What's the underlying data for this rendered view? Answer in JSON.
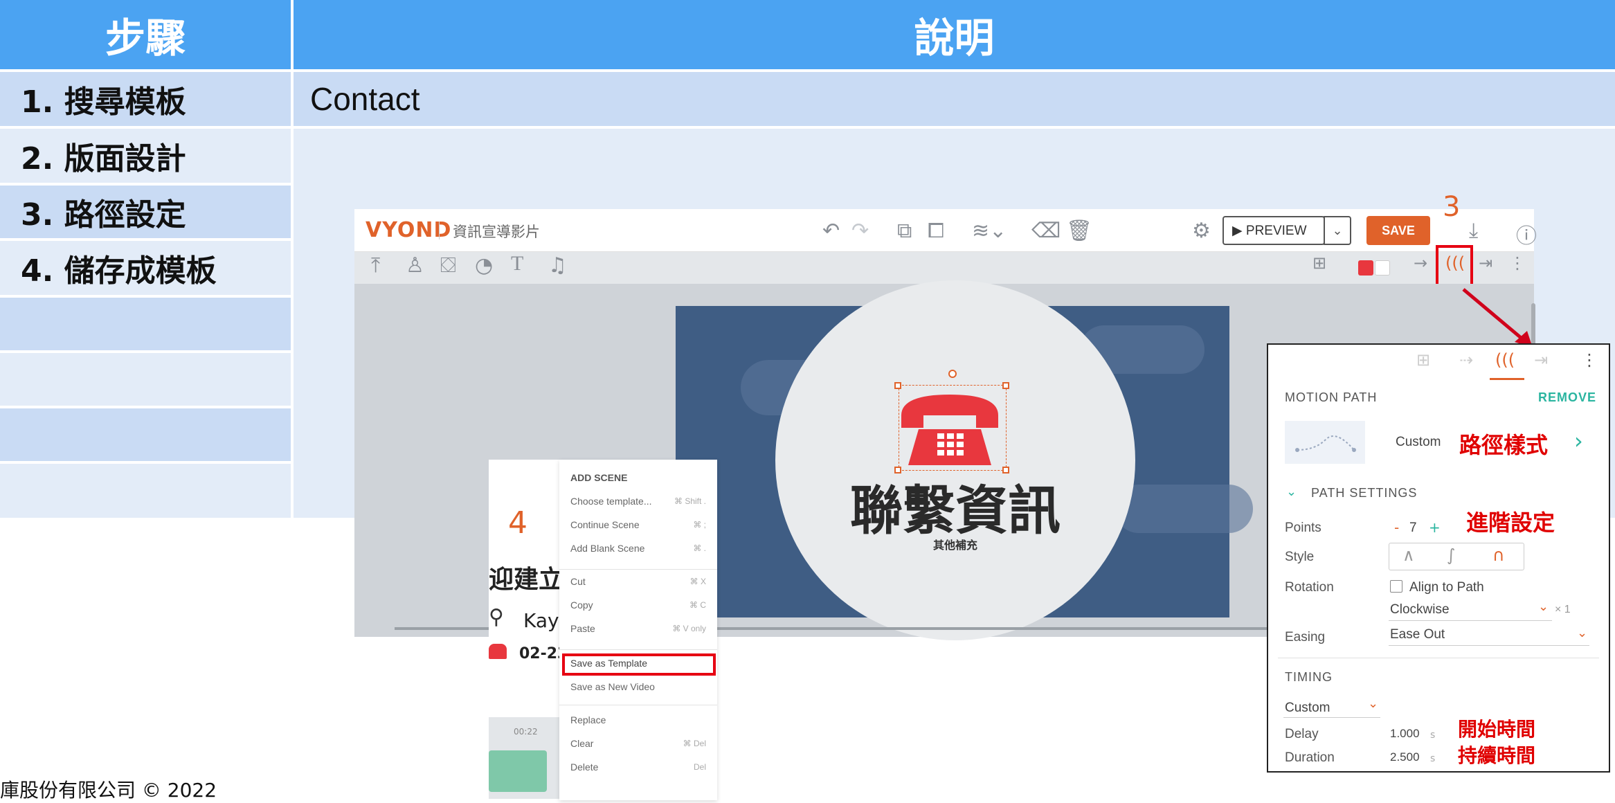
{
  "table": {
    "header_step": "步驟",
    "header_desc": "說明",
    "steps": [
      "1. 搜尋模板",
      "2. 版面設計",
      "3. 路徑設定",
      "4. 儲存成模板"
    ],
    "row1_desc": "Contact"
  },
  "footer": "庫股份有限公司 © 2022",
  "app": {
    "logo": "VYOND",
    "project_title": "資訊宣導影片",
    "preview_label": "▶ PREVIEW",
    "save_label": "SAVE",
    "callout3": "3",
    "callout4": "4"
  },
  "slide": {
    "title": "聯繫資訊",
    "subtitle": "其他補充"
  },
  "panel": {
    "motion_path": "MOTION PATH",
    "remove": "REMOVE",
    "custom": "Custom",
    "path_style_note": "路徑樣式",
    "path_settings": "PATH SETTINGS",
    "advanced_note": "進階設定",
    "points_label": "Points",
    "points_value": "7",
    "style_label": "Style",
    "rotation_label": "Rotation",
    "align_to_path": "Align to Path",
    "clockwise": "Clockwise",
    "times": "× 1",
    "easing_label": "Easing",
    "easing_value": "Ease Out",
    "timing": "TIMING",
    "timing_mode": "Custom",
    "delay_label": "Delay",
    "delay_value": "1.000",
    "duration_label": "Duration",
    "duration_value": "2.500",
    "unit": "s",
    "start_note": "開始時間",
    "duration_note": "持續時間"
  },
  "menu": {
    "items": [
      {
        "label": "ADD SCENE",
        "shortcut": ""
      },
      {
        "label": "Choose template...",
        "shortcut": "⌘ Shift ."
      },
      {
        "label": "Continue Scene",
        "shortcut": "⌘ ;"
      },
      {
        "label": "Add Blank Scene",
        "shortcut": "⌘ ."
      },
      {
        "label": "Cut",
        "shortcut": "⌘ X"
      },
      {
        "label": "Copy",
        "shortcut": "⌘ C"
      },
      {
        "label": "Paste",
        "shortcut": "⌘ V only"
      },
      {
        "label": "Save as Template",
        "shortcut": ""
      },
      {
        "label": "Save as New Video",
        "shortcut": ""
      },
      {
        "label": "Replace",
        "shortcut": ""
      },
      {
        "label": "Clear",
        "shortcut": "⌘ Del"
      },
      {
        "label": "Delete",
        "shortcut": "Del"
      }
    ]
  },
  "bg_slide": {
    "title_partial": "迎建立",
    "name_partial": "Kay",
    "phone_partial": "02-23",
    "time": "00:22"
  }
}
